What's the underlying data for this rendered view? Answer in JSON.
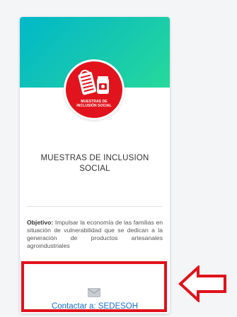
{
  "card": {
    "logo": {
      "icon": "artisan-products-logo-icon",
      "line1": "MUESTRAS DE",
      "line2": "INCLUSIÓN SOCIAL",
      "color": "#e1141d"
    },
    "header_colors": [
      "#00b8c9",
      "#26d99a"
    ],
    "title": "MUESTRAS DE INCLUSION SOCIAL",
    "description_label": "Objetivo:",
    "description_text": " Impulsar la economía de las familias en situación de vulnerabilidad que se dedican a la generación de productos artesanales agroindustriales",
    "contact": {
      "icon": "envelope-icon",
      "label": "Contactar a: SEDESOH",
      "color": "#1b6fc9"
    }
  },
  "annotation": {
    "box_color": "#e0121b",
    "arrow_icon": "left-arrow-icon"
  }
}
